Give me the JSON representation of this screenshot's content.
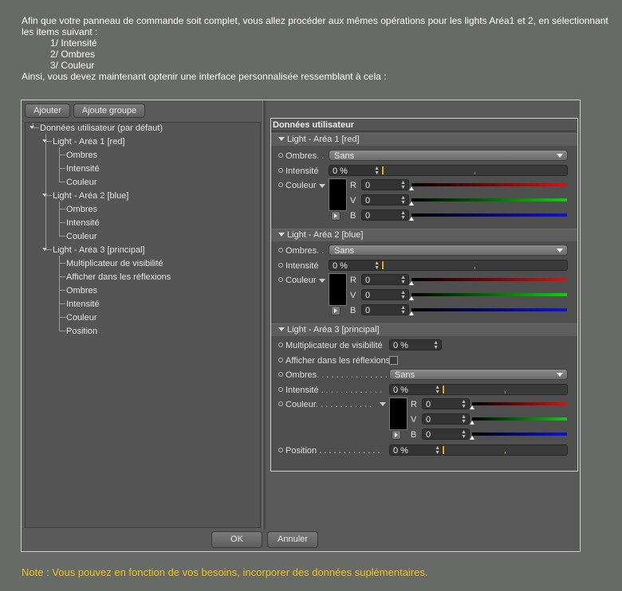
{
  "intro": {
    "line1": "Afin que votre panneau de commande soit complet, vous allez procéder aux mêmes opérations pour les lights Aréa1 et 2, en sélectionnant les items suivant :",
    "item1": "1/ Intensité",
    "item2": "2/ Ombres",
    "item3": "3/ Couleur",
    "line2": "Ainsi, vous devez maintenant optenir une interface personnalisée ressemblant à cela :"
  },
  "toolbar": {
    "add_label": "Ajouter",
    "add_group_label": "Ajoute groupe"
  },
  "tree": {
    "root": "Données utilisateur (par défaut)",
    "g1": "Light - Aréa 1 [red]",
    "g2": "Light - Aréa 2 [blue]",
    "g3": "Light - Aréa 3 [principal]",
    "ombres": "Ombres",
    "intensite": "Intensité",
    "couleur": "Couleur",
    "mult": "Multiplicateur de visibilité",
    "refl": "Afficher dans les réflexions",
    "position": "Position"
  },
  "panel": {
    "title": "Données utilisateur",
    "g1": "Light - Aréa 1 [red]",
    "g2": "Light - Aréa 2 [blue]",
    "g3": "Light - Aréa 3 [principal]",
    "ombres_short": "Ombres. .",
    "ombres_long": "Ombres. . . . . . . . . . . . . . .",
    "intensite": "Intensité",
    "intensite_long": "Intensité . . . . . . . . . . . . .",
    "couleur": "Couleur",
    "couleur_long": "Couleur. . . . . . . . . . . .",
    "mult": "Multiplicateur de visibilité",
    "refl": "Afficher dans les réflexions",
    "position_long": "Position . . . . . . . . . . . . .",
    "sans": "Sans",
    "zero_pct": "0 %",
    "zero": "0",
    "r": "R",
    "v": "V",
    "b": "B"
  },
  "dialog": {
    "ok_label": "OK",
    "cancel_label": "Annuler"
  },
  "note": "Note : Vous pouvez en fonction de vos besoins, incorporer des données suplémentaires.",
  "colors": {
    "accent": "#f0a51e",
    "note": "#f2c21b",
    "red": "#e01010",
    "green": "#10d010",
    "blue": "#1010e0"
  }
}
